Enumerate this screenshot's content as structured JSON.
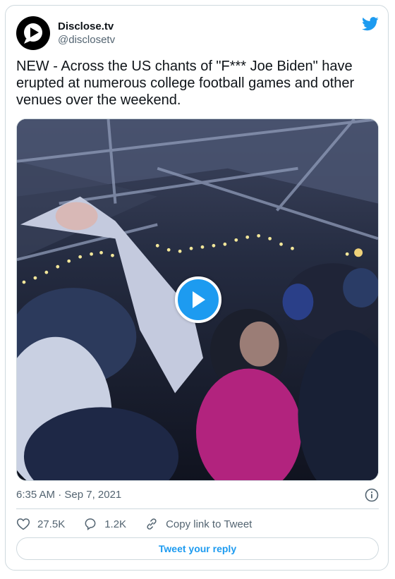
{
  "author": {
    "display_name": "Disclose.tv",
    "handle": "@disclosetv",
    "avatar_icon": "disclose-logo-icon"
  },
  "brand_icon": "twitter-bird-icon",
  "tweet": {
    "text": "NEW - Across the US chants of \"F*** Joe Biden\" have erupted at numerous college football games and other venues over the weekend."
  },
  "media": {
    "type": "video",
    "play_icon": "play-icon"
  },
  "meta": {
    "timestamp": "6:35 AM · Sep 7, 2021",
    "info_icon": "info-icon"
  },
  "actions": {
    "likes": "27.5K",
    "replies": "1.2K",
    "copy_link": "Copy link to Tweet"
  },
  "reply_button": "Tweet your reply",
  "colors": {
    "accent": "#1d9bf0",
    "text": "#0f1419",
    "secondary": "#536471",
    "border": "#cfd9de"
  }
}
